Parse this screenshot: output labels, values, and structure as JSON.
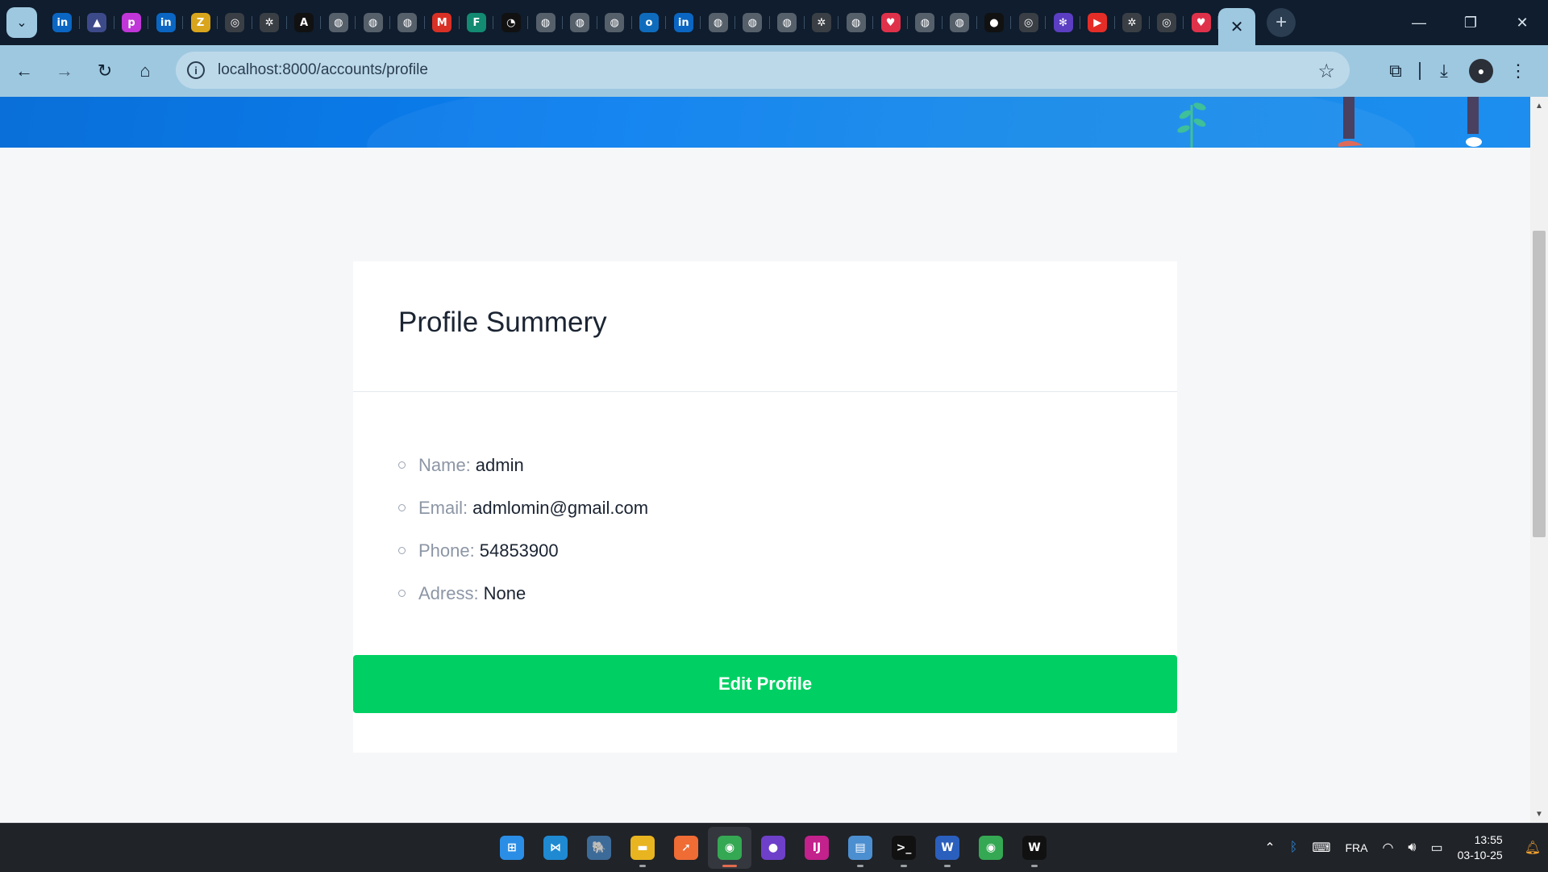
{
  "browser": {
    "tab_favicons": [
      {
        "icon": "linkedin-icon",
        "glyph": "in",
        "color": "#0a66c2"
      },
      {
        "icon": "arc-icon",
        "glyph": "▲",
        "color": "#3d4a8a"
      },
      {
        "icon": "picsart-icon",
        "glyph": "p",
        "color": "#c136d8"
      },
      {
        "icon": "linkedin-icon",
        "glyph": "in",
        "color": "#0a66c2"
      },
      {
        "icon": "zoho-icon",
        "glyph": "Z",
        "color": "#d9a51c"
      },
      {
        "icon": "chrome-icon",
        "glyph": "◎",
        "color": "#3a3f45"
      },
      {
        "icon": "chatgpt-icon",
        "glyph": "✲",
        "color": "#3a3f45"
      },
      {
        "icon": "notion-icon",
        "glyph": "A",
        "color": "#111111"
      },
      {
        "icon": "globe-icon",
        "glyph": "◍",
        "color": "#56606b"
      },
      {
        "icon": "globe-icon",
        "glyph": "◍",
        "color": "#56606b"
      },
      {
        "icon": "globe-icon",
        "glyph": "◍",
        "color": "#56606b"
      },
      {
        "icon": "gmail-icon",
        "glyph": "M",
        "color": "#d93025"
      },
      {
        "icon": "forms-icon",
        "glyph": "F",
        "color": "#138a72"
      },
      {
        "icon": "speedometer-icon",
        "glyph": "◔",
        "color": "#111111"
      },
      {
        "icon": "globe-icon",
        "glyph": "◍",
        "color": "#56606b"
      },
      {
        "icon": "globe-icon",
        "glyph": "◍",
        "color": "#56606b"
      },
      {
        "icon": "globe-icon",
        "glyph": "◍",
        "color": "#56606b"
      },
      {
        "icon": "outlook-icon",
        "glyph": "o",
        "color": "#0f6cbd"
      },
      {
        "icon": "linkedin-icon",
        "glyph": "in",
        "color": "#0a66c2"
      },
      {
        "icon": "globe-icon",
        "glyph": "◍",
        "color": "#56606b"
      },
      {
        "icon": "globe-icon",
        "glyph": "◍",
        "color": "#56606b"
      },
      {
        "icon": "globe-icon",
        "glyph": "◍",
        "color": "#56606b"
      },
      {
        "icon": "chatgpt-icon",
        "glyph": "✲",
        "color": "#3a3f45"
      },
      {
        "icon": "globe-icon",
        "glyph": "◍",
        "color": "#56606b"
      },
      {
        "icon": "heart-icon",
        "glyph": "♥",
        "color": "#e0314b"
      },
      {
        "icon": "globe-icon",
        "glyph": "◍",
        "color": "#56606b"
      },
      {
        "icon": "globe-icon",
        "glyph": "◍",
        "color": "#56606b"
      },
      {
        "icon": "github-icon",
        "glyph": "●",
        "color": "#111111"
      },
      {
        "icon": "chrome-icon",
        "glyph": "◎",
        "color": "#3a3f45"
      },
      {
        "icon": "network-icon",
        "glyph": "✻",
        "color": "#5b3ec2"
      },
      {
        "icon": "youtube-icon",
        "glyph": "▶",
        "color": "#e52d27"
      },
      {
        "icon": "chatgpt-icon",
        "glyph": "✲",
        "color": "#3a3f45"
      },
      {
        "icon": "chrome-icon",
        "glyph": "◎",
        "color": "#3a3f45"
      },
      {
        "icon": "heart-icon",
        "glyph": "♥",
        "color": "#e0314b"
      }
    ],
    "active_tab_close": "✕",
    "new_tab": "+",
    "url": "localhost:8000/accounts/profile"
  },
  "profile": {
    "title": "Profile Summery",
    "fields": [
      {
        "label": "Name:",
        "value": "admin"
      },
      {
        "label": "Email:",
        "value": "admlomin@gmail.com"
      },
      {
        "label": "Phone:",
        "value": "54853900"
      },
      {
        "label": "Adress:",
        "value": "None"
      }
    ],
    "edit_button": "Edit Profile"
  },
  "colors": {
    "accent_green": "#00d063",
    "hero_blue": "#0a7ff0",
    "chrome_blue": "#9ec8e0"
  },
  "taskbar": {
    "apps": [
      {
        "icon": "windows-start-icon",
        "glyph": "⊞",
        "color": "#2b8ee6"
      },
      {
        "icon": "vscode-icon",
        "glyph": "⋈",
        "color": "#1f8ad2"
      },
      {
        "icon": "postgresql-icon",
        "glyph": "🐘",
        "color": "#3d6b99"
      },
      {
        "icon": "file-explorer-icon",
        "glyph": "▬",
        "color": "#e8b420"
      },
      {
        "icon": "postman-icon",
        "glyph": "➚",
        "color": "#ef6c35"
      },
      {
        "icon": "chrome-icon",
        "glyph": "◉",
        "color": "#35a853",
        "active": true
      },
      {
        "icon": "github-desktop-icon",
        "glyph": "●",
        "color": "#6e40c9"
      },
      {
        "icon": "intellij-icon",
        "glyph": "IJ",
        "color": "#c3218c"
      },
      {
        "icon": "remote-desktop-icon",
        "glyph": "▤",
        "color": "#4c8fd1"
      },
      {
        "icon": "terminal-icon",
        "glyph": ">_",
        "color": "#111111"
      },
      {
        "icon": "word-icon",
        "glyph": "W",
        "color": "#2b5fbd"
      },
      {
        "icon": "chrome-icon",
        "glyph": "◉",
        "color": "#35a853"
      },
      {
        "icon": "wakatime-icon",
        "glyph": "W",
        "color": "#111111"
      }
    ],
    "tray_language": "FRA",
    "time": "13:55",
    "date": "03-10-25"
  }
}
